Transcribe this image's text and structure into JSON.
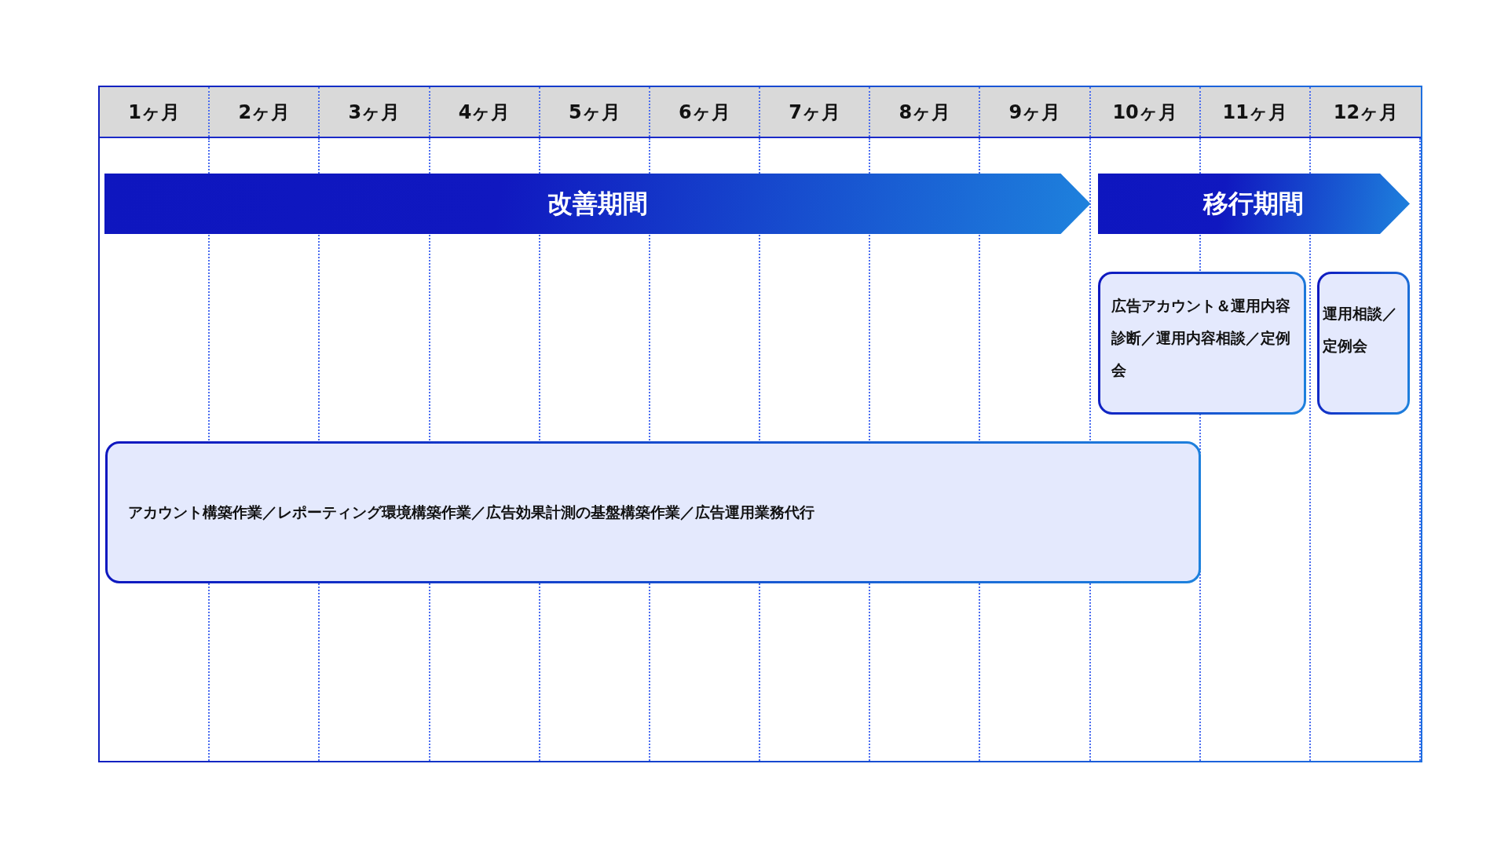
{
  "months": [
    "1ヶ月",
    "2ヶ月",
    "3ヶ月",
    "4ヶ月",
    "5ヶ月",
    "6ヶ月",
    "7ヶ月",
    "8ヶ月",
    "9ヶ月",
    "10ヶ月",
    "11ヶ月",
    "12ヶ月"
  ],
  "phases": [
    {
      "label": "改善期間"
    },
    {
      "label": "移行期間"
    }
  ],
  "tasks": [
    {
      "text": "広告アカウント＆運用内容診断／運用内容相談／定例会"
    },
    {
      "text": "運用相談／定例会"
    },
    {
      "text": "アカウント構築作業／レポーティング環境構築作業／広告効果計測の基盤構築作業／広告運用業務代行"
    }
  ]
}
